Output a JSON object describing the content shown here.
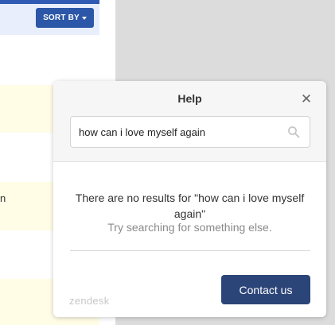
{
  "background": {
    "sort_label": "SORT BY",
    "row_fragment": "n"
  },
  "help_widget": {
    "title": "Help",
    "close_icon": "close-icon",
    "search": {
      "value": "how can i love myself again",
      "icon": "search-icon"
    },
    "no_results_message": "There are no results for \"how can i love myself again\"",
    "suggestion": "Try searching for something else.",
    "brand": "zendesk",
    "contact_label": "Contact us"
  },
  "colors": {
    "primary_button": "#2c4579",
    "sort_button": "#2c56a8",
    "highlight_row": "#fffde6"
  }
}
